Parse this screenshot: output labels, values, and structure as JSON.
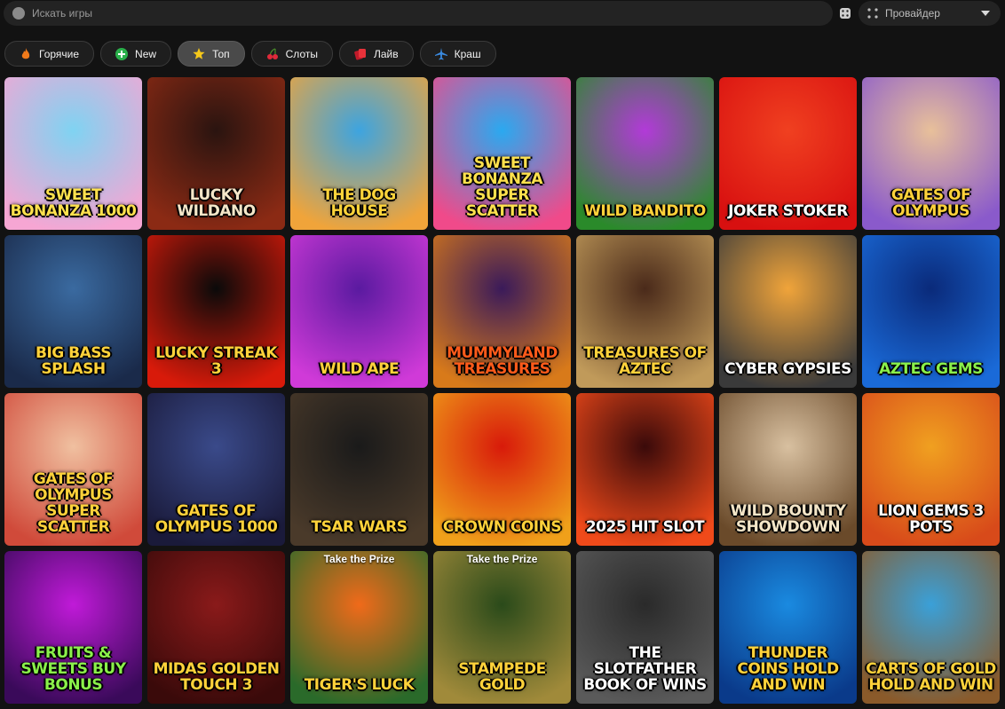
{
  "search": {
    "placeholder": "Искать игры"
  },
  "provider": {
    "label": "Провайдер"
  },
  "tabs": [
    {
      "label": "Горячие",
      "icon": "fire-icon",
      "active": false
    },
    {
      "label": "New",
      "icon": "plus-circle-icon",
      "active": false
    },
    {
      "label": "Топ",
      "icon": "star-icon",
      "active": true
    },
    {
      "label": "Слоты",
      "icon": "cherries-icon",
      "active": false
    },
    {
      "label": "Лайв",
      "icon": "cards-icon",
      "active": false
    },
    {
      "label": "Краш",
      "icon": "airplane-icon",
      "active": false
    }
  ],
  "games": [
    {
      "title": "Sweet Bonanza 1000",
      "bg": [
        "#7fd3f2",
        "#f6a6d3"
      ],
      "color": "#ffe14d"
    },
    {
      "title": "Lucky Wildano",
      "bg": [
        "#2a1410",
        "#8b2a14"
      ],
      "color": "#f4e6c8"
    },
    {
      "title": "The Dog House",
      "bg": [
        "#3da4e0",
        "#f0a43a"
      ],
      "color": "#ffd43a"
    },
    {
      "title": "Sweet Bonanza Super Scatter",
      "bg": [
        "#2aa9f0",
        "#f04a8a"
      ],
      "color": "#ffe14d"
    },
    {
      "title": "Wild Bandito",
      "bg": [
        "#b23ad8",
        "#2a8a2a"
      ],
      "color": "#ffd23a"
    },
    {
      "title": "Joker Stoker",
      "bg": [
        "#f04020",
        "#d81010"
      ],
      "color": "#ffffff"
    },
    {
      "title": "Gates of Olympus",
      "bg": [
        "#e8c09a",
        "#8a5acb"
      ],
      "color": "#ffd23a"
    },
    {
      "title": "Big Bass Splash",
      "bg": [
        "#3a6aa0",
        "#1a2a4a"
      ],
      "color": "#ffd23a"
    },
    {
      "title": "Lucky Streak 3",
      "bg": [
        "#0a0a0a",
        "#d81a0a"
      ],
      "color": "#ffd23a"
    },
    {
      "title": "Wild Ape",
      "bg": [
        "#5a1aa0",
        "#d03ad8"
      ],
      "color": "#ffd23a"
    },
    {
      "title": "Mummyland Treasures",
      "bg": [
        "#3a1a5a",
        "#d87a1a"
      ],
      "color": "#ff5a1a"
    },
    {
      "title": "Treasures of Aztec",
      "bg": [
        "#4a2a1a",
        "#c09a5a"
      ],
      "color": "#ffd23a"
    },
    {
      "title": "Cyber Gypsies",
      "bg": [
        "#f0a43a",
        "#3a3a3a"
      ],
      "color": "#ffffff"
    },
    {
      "title": "Aztec Gems",
      "bg": [
        "#0a2a7a",
        "#1a6ad8"
      ],
      "color": "#8af04a"
    },
    {
      "title": "Gates of Olympus Super Scatter",
      "bg": [
        "#f0c0a0",
        "#d04a3a"
      ],
      "color": "#ffd23a"
    },
    {
      "title": "Gates of Olympus 1000",
      "bg": [
        "#3a4a8a",
        "#1a1a3a"
      ],
      "color": "#ffd23a"
    },
    {
      "title": "Tsar Wars",
      "bg": [
        "#1a1a1a",
        "#4a3a2a"
      ],
      "color": "#ffd23a"
    },
    {
      "title": "Crown Coins",
      "bg": [
        "#d81a0a",
        "#f0a01a"
      ],
      "color": "#ffd23a"
    },
    {
      "title": "2025 Hit Slot",
      "bg": [
        "#3a0a0a",
        "#f04a1a"
      ],
      "color": "#ffffff"
    },
    {
      "title": "Wild Bounty Showdown",
      "bg": [
        "#d8c0a0",
        "#6a4a2a"
      ],
      "color": "#f4e6c8"
    },
    {
      "title": "Lion Gems 3 Pots",
      "bg": [
        "#f0a020",
        "#d84a1a"
      ],
      "color": "#ffffff"
    },
    {
      "title": "Fruits & Sweets Buy Bonus",
      "bg": [
        "#c01ad8",
        "#3a0a5a"
      ],
      "color": "#8af04a"
    },
    {
      "title": "Midas Golden Touch 3",
      "bg": [
        "#8a1a1a",
        "#3a0a0a"
      ],
      "color": "#ffd23a"
    },
    {
      "title": "Tiger's Luck",
      "bg": [
        "#f06a1a",
        "#2a6a2a"
      ],
      "color": "#ffd23a",
      "badge": "Take the Prize"
    },
    {
      "title": "Stampede Gold",
      "bg": [
        "#2a4a1a",
        "#a08a3a"
      ],
      "color": "#ffd23a",
      "badge": "Take the Prize"
    },
    {
      "title": "The Slotfather Book of Wins",
      "bg": [
        "#2a2a2a",
        "#5a5a5a"
      ],
      "color": "#ffffff"
    },
    {
      "title": "Thunder Coins Hold and Win",
      "bg": [
        "#1a8ae0",
        "#0a3a8a"
      ],
      "color": "#ffd23a"
    },
    {
      "title": "Carts of Gold Hold and Win",
      "bg": [
        "#3aa0d8",
        "#8a5a2a"
      ],
      "color": "#ffd23a"
    }
  ]
}
